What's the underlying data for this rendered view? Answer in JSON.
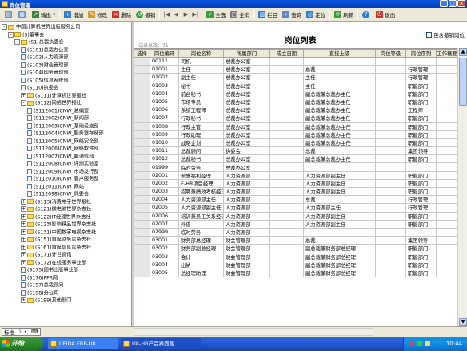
{
  "window": {
    "title": "岗位管理"
  },
  "toolbar": {
    "output": "输出",
    "add": "增加",
    "modify": "修改",
    "delete": "删除",
    "revoke": "撤销",
    "select_all": "全选",
    "deselect_all": "全消",
    "columns": "栏目",
    "query": "查询",
    "locate": "定位",
    "refresh": "刷新",
    "exit": "退出"
  },
  "tree": [
    {
      "label": "中国计算机世界出版服务公司",
      "indent": 0,
      "kind": "folder",
      "exp": "-"
    },
    {
      "label": "(S)董事会",
      "indent": 1,
      "kind": "folder",
      "exp": "-"
    },
    {
      "label": "(S1)总裁执委会",
      "indent": 2,
      "kind": "folder",
      "exp": "-"
    },
    {
      "label": "(S101)总裁办公室",
      "indent": 3,
      "kind": "doc"
    },
    {
      "label": "(S102)人力资源部",
      "indent": 3,
      "kind": "doc"
    },
    {
      "label": "(S103)财会管理部",
      "indent": 3,
      "kind": "doc"
    },
    {
      "label": "(S104)印务管理部",
      "indent": 3,
      "kind": "doc"
    },
    {
      "label": "(S105)信息系统部",
      "indent": 3,
      "kind": "doc"
    },
    {
      "label": "(S110)执委会",
      "indent": 3,
      "kind": "doc"
    },
    {
      "label": "(S111)计算机世界报社",
      "indent": 3,
      "kind": "folder",
      "exp": "+"
    },
    {
      "label": "(S112)网络世界报社",
      "indent": 3,
      "kind": "folder",
      "exp": "-"
    },
    {
      "label": "(S112001)CNW_总编室",
      "indent": 4,
      "kind": "doc"
    },
    {
      "label": "(S112002)CNW_新闻部",
      "indent": 4,
      "kind": "doc"
    },
    {
      "label": "(S112003)CNW_基础设施部",
      "indent": 4,
      "kind": "doc"
    },
    {
      "label": "(S112004)CNW_服务器存储部",
      "indent": 4,
      "kind": "doc"
    },
    {
      "label": "(S112005)CNW_网络安全部",
      "indent": 4,
      "kind": "doc"
    },
    {
      "label": "(S112006)CNW_网络软件部",
      "indent": 4,
      "kind": "doc"
    },
    {
      "label": "(S112007)CNW_邮通信部",
      "indent": 4,
      "kind": "doc"
    },
    {
      "label": "(S112008)CNW_评测实验室",
      "indent": 4,
      "kind": "doc"
    },
    {
      "label": "(S112009)CNW_市场发行部",
      "indent": 4,
      "kind": "doc"
    },
    {
      "label": "(S112010)CNW_客户服务部",
      "indent": 4,
      "kind": "doc"
    },
    {
      "label": "(S112011)CNW_网站",
      "indent": 4,
      "kind": "doc"
    },
    {
      "label": "(S112098)CNW_佩委会",
      "indent": 4,
      "kind": "doc"
    },
    {
      "label": "(S113)消费电子世界报社",
      "indent": 3,
      "kind": "folder",
      "exp": "+"
    },
    {
      "label": "(S121)微电脑世界杂志社",
      "indent": 3,
      "kind": "folder",
      "exp": "+"
    },
    {
      "label": "(S122)IT经理世界杂志社",
      "indent": 3,
      "kind": "folder",
      "exp": "+"
    },
    {
      "label": "(S123)影响精品世界杂志社",
      "indent": 3,
      "kind": "folder",
      "exp": "+"
    },
    {
      "label": "(S131)中国数字电视杂志社",
      "indent": 3,
      "kind": "folder",
      "exp": "+"
    },
    {
      "label": "(S151)首席财务官杂志社",
      "indent": 3,
      "kind": "folder",
      "exp": "+"
    },
    {
      "label": "(S161)首席信息官杂志社",
      "indent": 3,
      "kind": "folder",
      "exp": "+"
    },
    {
      "label": "(S171)计世资讯",
      "indent": 3,
      "kind": "folder",
      "exp": "+"
    },
    {
      "label": "(S172)在线服务事业部",
      "indent": 3,
      "kind": "folder",
      "exp": "+"
    },
    {
      "label": "(S175)图书出版事业部",
      "indent": 3,
      "kind": "doc"
    },
    {
      "label": "(S176)FFR网",
      "indent": 3,
      "kind": "doc"
    },
    {
      "label": "(S197)总裁顾问",
      "indent": 3,
      "kind": "doc"
    },
    {
      "label": "(S198)分公司",
      "indent": 3,
      "kind": "doc"
    },
    {
      "label": "(S199)其他部门",
      "indent": 3,
      "kind": "folder",
      "exp": "+"
    }
  ],
  "main": {
    "record_count": "记录总数：71",
    "title": "岗位列表",
    "include_revoked": "包含撤销岗位"
  },
  "table": {
    "headers": [
      "选择",
      "岗位编码",
      "岗位名称",
      "所属部门",
      "成立日期",
      "直接上级",
      "岗位等级",
      "岗位序列",
      "工作概要"
    ],
    "rows": [
      [
        "",
        "00111",
        "司机",
        "总裁办公室",
        "",
        "",
        "",
        "",
        ""
      ],
      [
        "",
        "01001",
        "主任",
        "总裁办公室",
        "",
        "总裁",
        "",
        "行政管理",
        ""
      ],
      [
        "",
        "01002",
        "副主任",
        "总裁办公室",
        "",
        "主任",
        "",
        "行政管理",
        ""
      ],
      [
        "",
        "01003",
        "秘书",
        "总裁办公室",
        "",
        "主任",
        "",
        "职能部门",
        ""
      ],
      [
        "",
        "01004",
        "前台秘书",
        "总裁办公室",
        "",
        "副总裁兼总裁办主任",
        "",
        "职能部门",
        ""
      ],
      [
        "",
        "01005",
        "市场专员",
        "总裁办公室",
        "",
        "副总裁兼总裁办主任",
        "",
        "职能部门",
        ""
      ],
      [
        "",
        "01006",
        "系统工程师",
        "总裁办公室",
        "",
        "副总裁兼总裁办主任",
        "",
        "工程师",
        ""
      ],
      [
        "",
        "01007",
        "行政秘书",
        "总裁办公室",
        "",
        "副总裁兼总裁办主任",
        "",
        "职能部门",
        ""
      ],
      [
        "",
        "01008",
        "行政主管",
        "总裁办公室",
        "",
        "副总裁兼总裁办主任",
        "",
        "职能部门",
        ""
      ],
      [
        "",
        "01009",
        "行政助理",
        "总裁办公室",
        "",
        "副总裁兼总裁办主任",
        "",
        "职能部门",
        ""
      ],
      [
        "",
        "01010",
        "战略企划",
        "总裁办公室",
        "",
        "副总裁兼总裁办主任",
        "",
        "职能部门",
        ""
      ],
      [
        "",
        "01011",
        "总裁顾问",
        "执委会",
        "",
        "总裁",
        "",
        "集团领导",
        ""
      ],
      [
        "",
        "01012",
        "总裁秘书",
        "总裁办公室",
        "",
        "副总裁兼总裁办主任",
        "",
        "职能部门",
        ""
      ],
      [
        "",
        "01999",
        "临时劳务",
        "总裁办公室",
        "",
        "",
        "",
        "",
        ""
      ],
      [
        "",
        "02001",
        "薪酬福利经理",
        "人力资源部",
        "",
        "人力资源部副主任",
        "",
        "职能部门",
        ""
      ],
      [
        "",
        "02002",
        "E-HR项目经理",
        "人力资源部",
        "",
        "人力资源部副主任",
        "",
        "职能部门",
        ""
      ],
      [
        "",
        "02003",
        "招聘兼绩效考核经理",
        "人力资源部",
        "",
        "人力资源部副主任",
        "",
        "职能部门",
        ""
      ],
      [
        "",
        "02004",
        "人力资源部主任",
        "人力资源部",
        "",
        "总裁",
        "",
        "行政管理",
        ""
      ],
      [
        "",
        "02005",
        "人力资源部副主任",
        "人力资源部",
        "",
        "人力资源部主任",
        "",
        "行政管理",
        ""
      ],
      [
        "",
        "02006",
        "培训兼员工关系经理",
        "人力资源部",
        "",
        "人力资源部副主任",
        "",
        "职能部门",
        ""
      ],
      [
        "",
        "02007",
        "外借",
        "人力资源部",
        "",
        "人力资源部副主任",
        "",
        "职能部门",
        ""
      ],
      [
        "",
        "02999",
        "临时劳务",
        "人力资源部",
        "",
        "",
        "",
        "",
        ""
      ],
      [
        "",
        "03001",
        "财务部总经理",
        "财会管理部",
        "",
        "总裁",
        "",
        "集团领导",
        ""
      ],
      [
        "",
        "03002",
        "财务部副总经理",
        "财会管理部",
        "",
        "副总裁兼财务部总经理",
        "",
        "职能部门",
        ""
      ],
      [
        "",
        "03003",
        "会计",
        "财会管理部",
        "",
        "副总裁兼财务部总经理",
        "",
        "职能部门",
        ""
      ],
      [
        "",
        "03004",
        "出纳",
        "财会管理部",
        "",
        "副总裁兼财务部总经理",
        "",
        "职能部门",
        ""
      ],
      [
        "",
        "03005",
        "总经理助理",
        "财会管理部",
        "",
        "副总裁兼财务部总经理",
        "",
        "职能部门",
        ""
      ]
    ]
  },
  "status": {
    "ime": "标准"
  },
  "taskbar": {
    "start": "开始",
    "tasks": [
      "UFIDA ERP-U8",
      "U8-HR产品界面截..."
    ],
    "time": "10:44"
  }
}
